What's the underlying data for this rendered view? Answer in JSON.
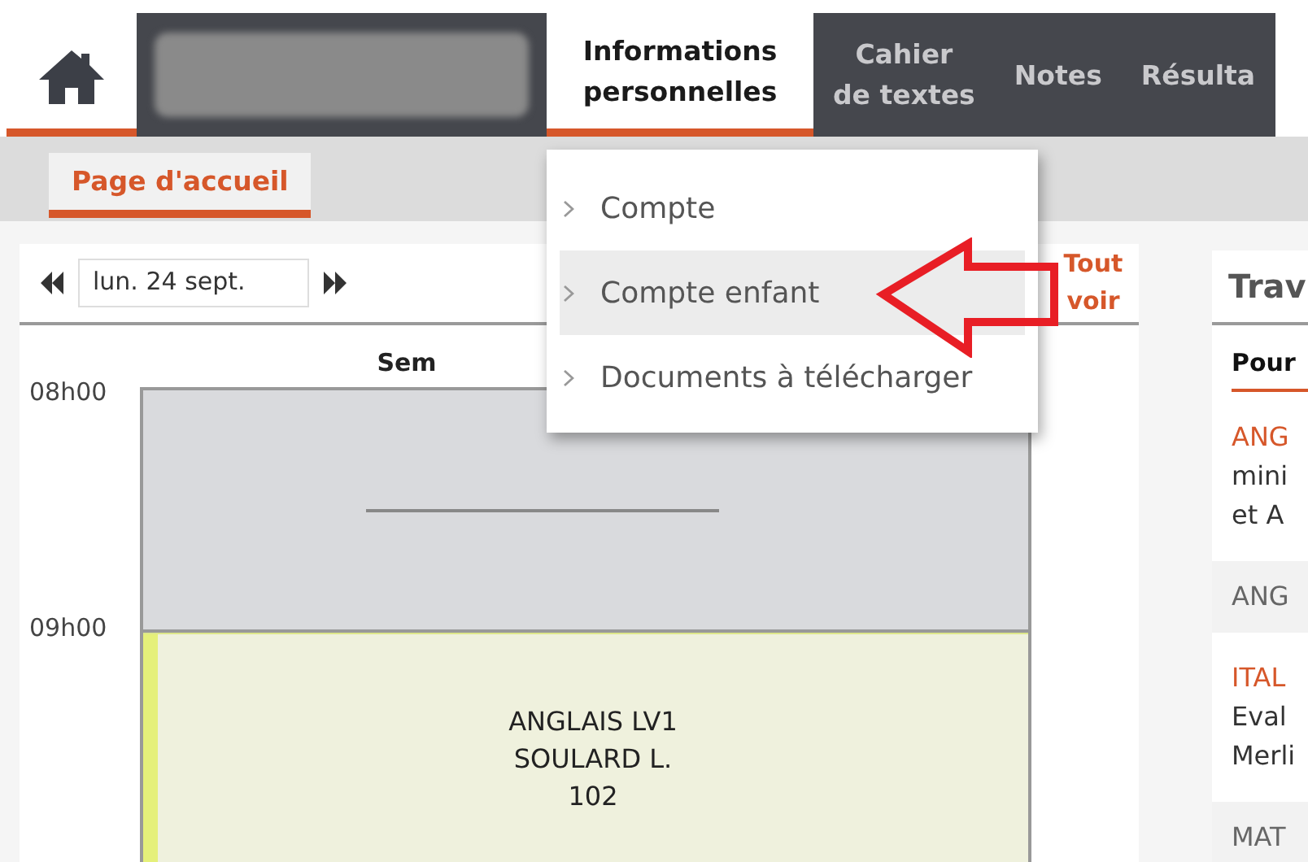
{
  "nav_tabs": [
    {
      "kind": "home",
      "selected": true
    },
    {
      "kind": "hidden",
      "selected": false
    },
    {
      "kind": "text",
      "label": "Informations\npersonnelles",
      "selected": true
    },
    {
      "kind": "text",
      "label": "Cahier\nde textes",
      "selected": false
    },
    {
      "kind": "text",
      "label": "Notes",
      "selected": false
    },
    {
      "kind": "text",
      "label": "Résulta",
      "selected": false
    }
  ],
  "menu": {
    "items": [
      {
        "label": "Compte",
        "selected": false
      },
      {
        "label": "Compte enfant",
        "selected": true
      },
      {
        "label": "Documents à télécharger",
        "selected": false
      }
    ]
  },
  "sub_tabs": [
    {
      "label": "Page d'accueil",
      "selected": true
    }
  ],
  "timetable": {
    "date": "lun. 24 sept.",
    "see_all": "Tout voir",
    "week_label": "Sem",
    "times": [
      "08h00",
      "09h00"
    ],
    "slots": [
      {
        "kind": "empty"
      },
      {
        "kind": "course",
        "color": "#e5f07a",
        "lines": [
          "ANGLAIS LV1",
          "SOULARD L.",
          "102"
        ]
      }
    ]
  },
  "homework": {
    "title": "Trav",
    "tabs": [
      {
        "label": "Pour",
        "selected": true
      }
    ],
    "items": [
      {
        "kind": "detail",
        "subject": "ANG",
        "lines": [
          "mini",
          "et A"
        ]
      },
      {
        "kind": "summary",
        "subject": "ANG"
      },
      {
        "kind": "detail",
        "subject": "ITAL",
        "lines": [
          "Eval",
          "Merli"
        ]
      },
      {
        "kind": "summary",
        "subject": "MAT"
      }
    ]
  }
}
